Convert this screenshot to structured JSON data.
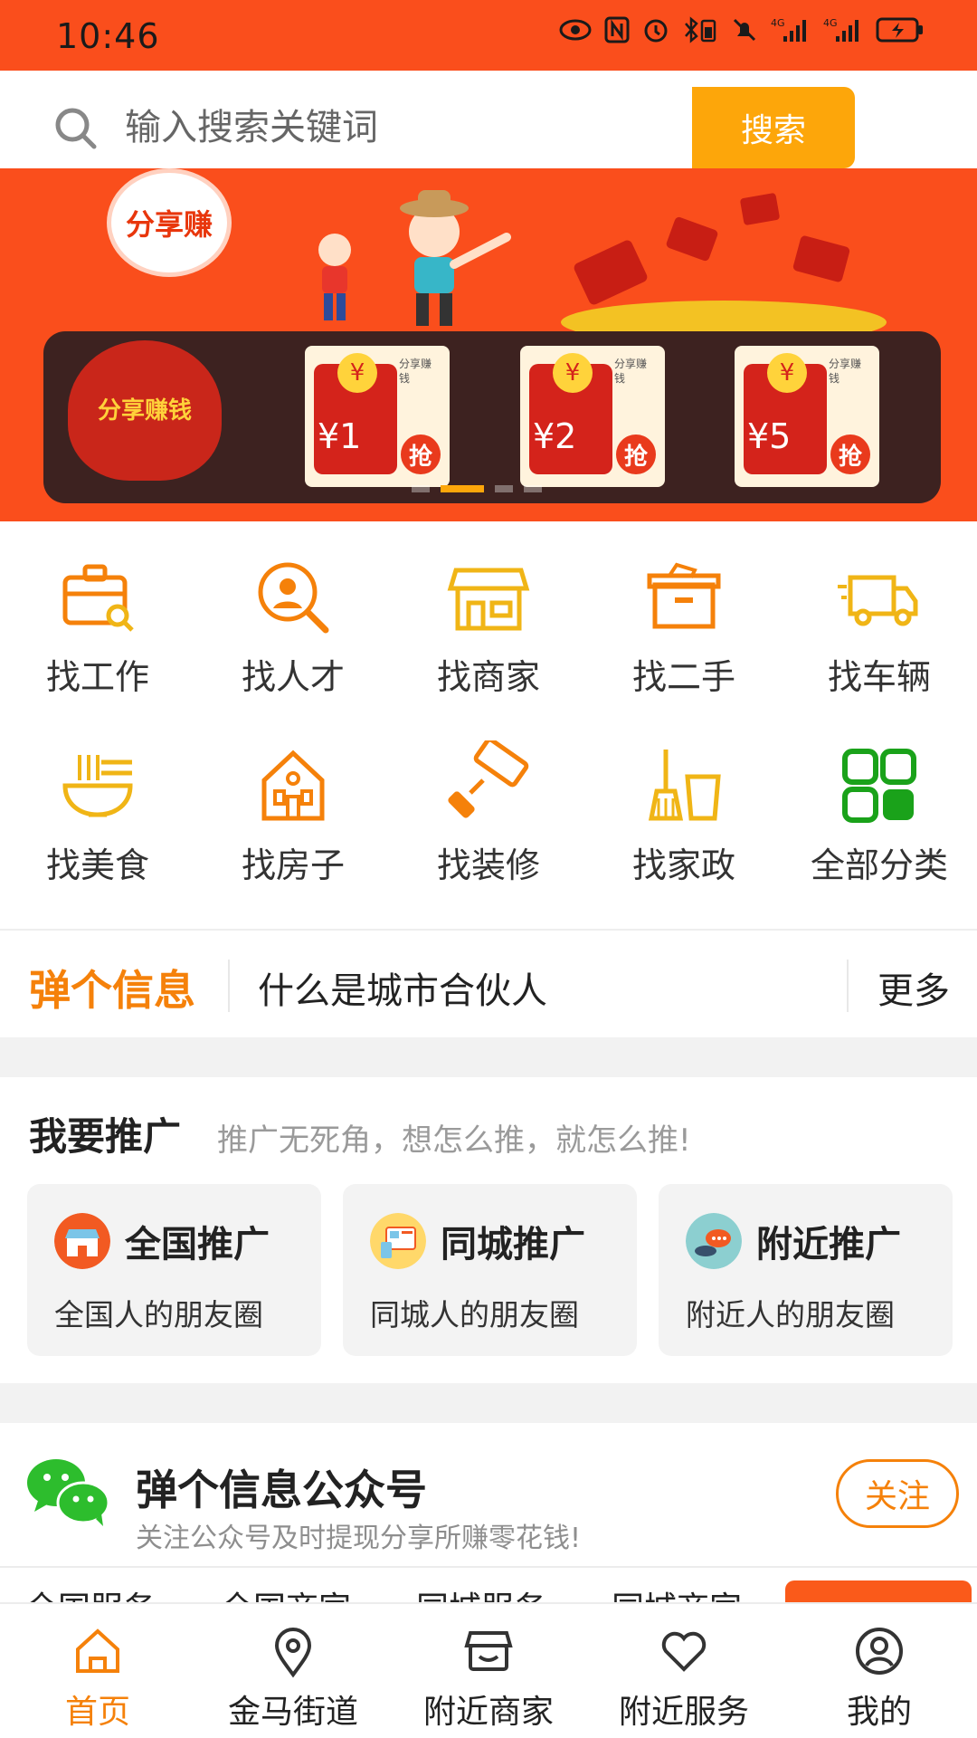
{
  "status_bar": {
    "time": "10:46",
    "icons": [
      "eye-icon",
      "nfc-icon",
      "alarm-icon",
      "bluetooth-battery-icon",
      "mute-bell-icon",
      "signal-4g-icon",
      "signal-4g-icon",
      "battery-charging-icon"
    ]
  },
  "search": {
    "placeholder": "输入搜索关键词",
    "button_label": "搜索"
  },
  "banner": {
    "bubble_text": "分享赚",
    "bag_text": "分享赚钱",
    "coupons": [
      {
        "amount": "¥1",
        "tag": "分享赚钱",
        "grab": "抢"
      },
      {
        "amount": "¥2",
        "tag": "分享赚钱",
        "grab": "抢"
      },
      {
        "amount": "¥5",
        "tag": "分享赚钱",
        "grab": "抢"
      }
    ],
    "active_page": 2,
    "page_count": 4
  },
  "categories": [
    {
      "label": "找工作",
      "icon": "briefcase-search-icon"
    },
    {
      "label": "找人才",
      "icon": "person-search-icon"
    },
    {
      "label": "找商家",
      "icon": "storefront-icon"
    },
    {
      "label": "找二手",
      "icon": "secondhand-box-icon"
    },
    {
      "label": "找车辆",
      "icon": "truck-icon"
    },
    {
      "label": "找美食",
      "icon": "noodle-bowl-icon"
    },
    {
      "label": "找房子",
      "icon": "house-icon"
    },
    {
      "label": "找装修",
      "icon": "paint-roller-icon"
    },
    {
      "label": "找家政",
      "icon": "broom-bucket-icon"
    },
    {
      "label": "全部分类",
      "icon": "all-categories-icon"
    }
  ],
  "ticker": {
    "brand": "弹个信息",
    "headline": "什么是城市合伙人",
    "more": "更多"
  },
  "promotion": {
    "title": "我要推广",
    "subtitle": "推广无死角，想怎么推，就怎么推!",
    "cards": [
      {
        "title": "全国推广",
        "desc": "全国人的朋友圈",
        "icon": "national-store-icon"
      },
      {
        "title": "同城推广",
        "desc": "同城人的朋友圈",
        "icon": "city-screen-icon"
      },
      {
        "title": "附近推广",
        "desc": "附近人的朋友圈",
        "icon": "nearby-chat-icon"
      }
    ]
  },
  "official_account": {
    "title": "弹个信息公众号",
    "subtitle": "关注公众号及时提现分享所赚零花钱!",
    "follow_label": "关注"
  },
  "tab_strip": [
    "全国服务",
    "全国商家",
    "同城服务",
    "同城商家"
  ],
  "bottom_nav": [
    {
      "label": "首页",
      "icon": "home-icon",
      "active": true
    },
    {
      "label": "金马街道",
      "icon": "location-pin-icon",
      "active": false
    },
    {
      "label": "附近商家",
      "icon": "shop-icon",
      "active": false
    },
    {
      "label": "附近服务",
      "icon": "heart-icon",
      "active": false
    },
    {
      "label": "我的",
      "icon": "profile-icon",
      "active": false
    }
  ],
  "colors": {
    "brand_orange": "#fa4e1c",
    "accent_orange": "#f5810a",
    "search_button": "#fda60a",
    "icon_gold": "#f0b516",
    "icon_green": "#1aa21a"
  }
}
